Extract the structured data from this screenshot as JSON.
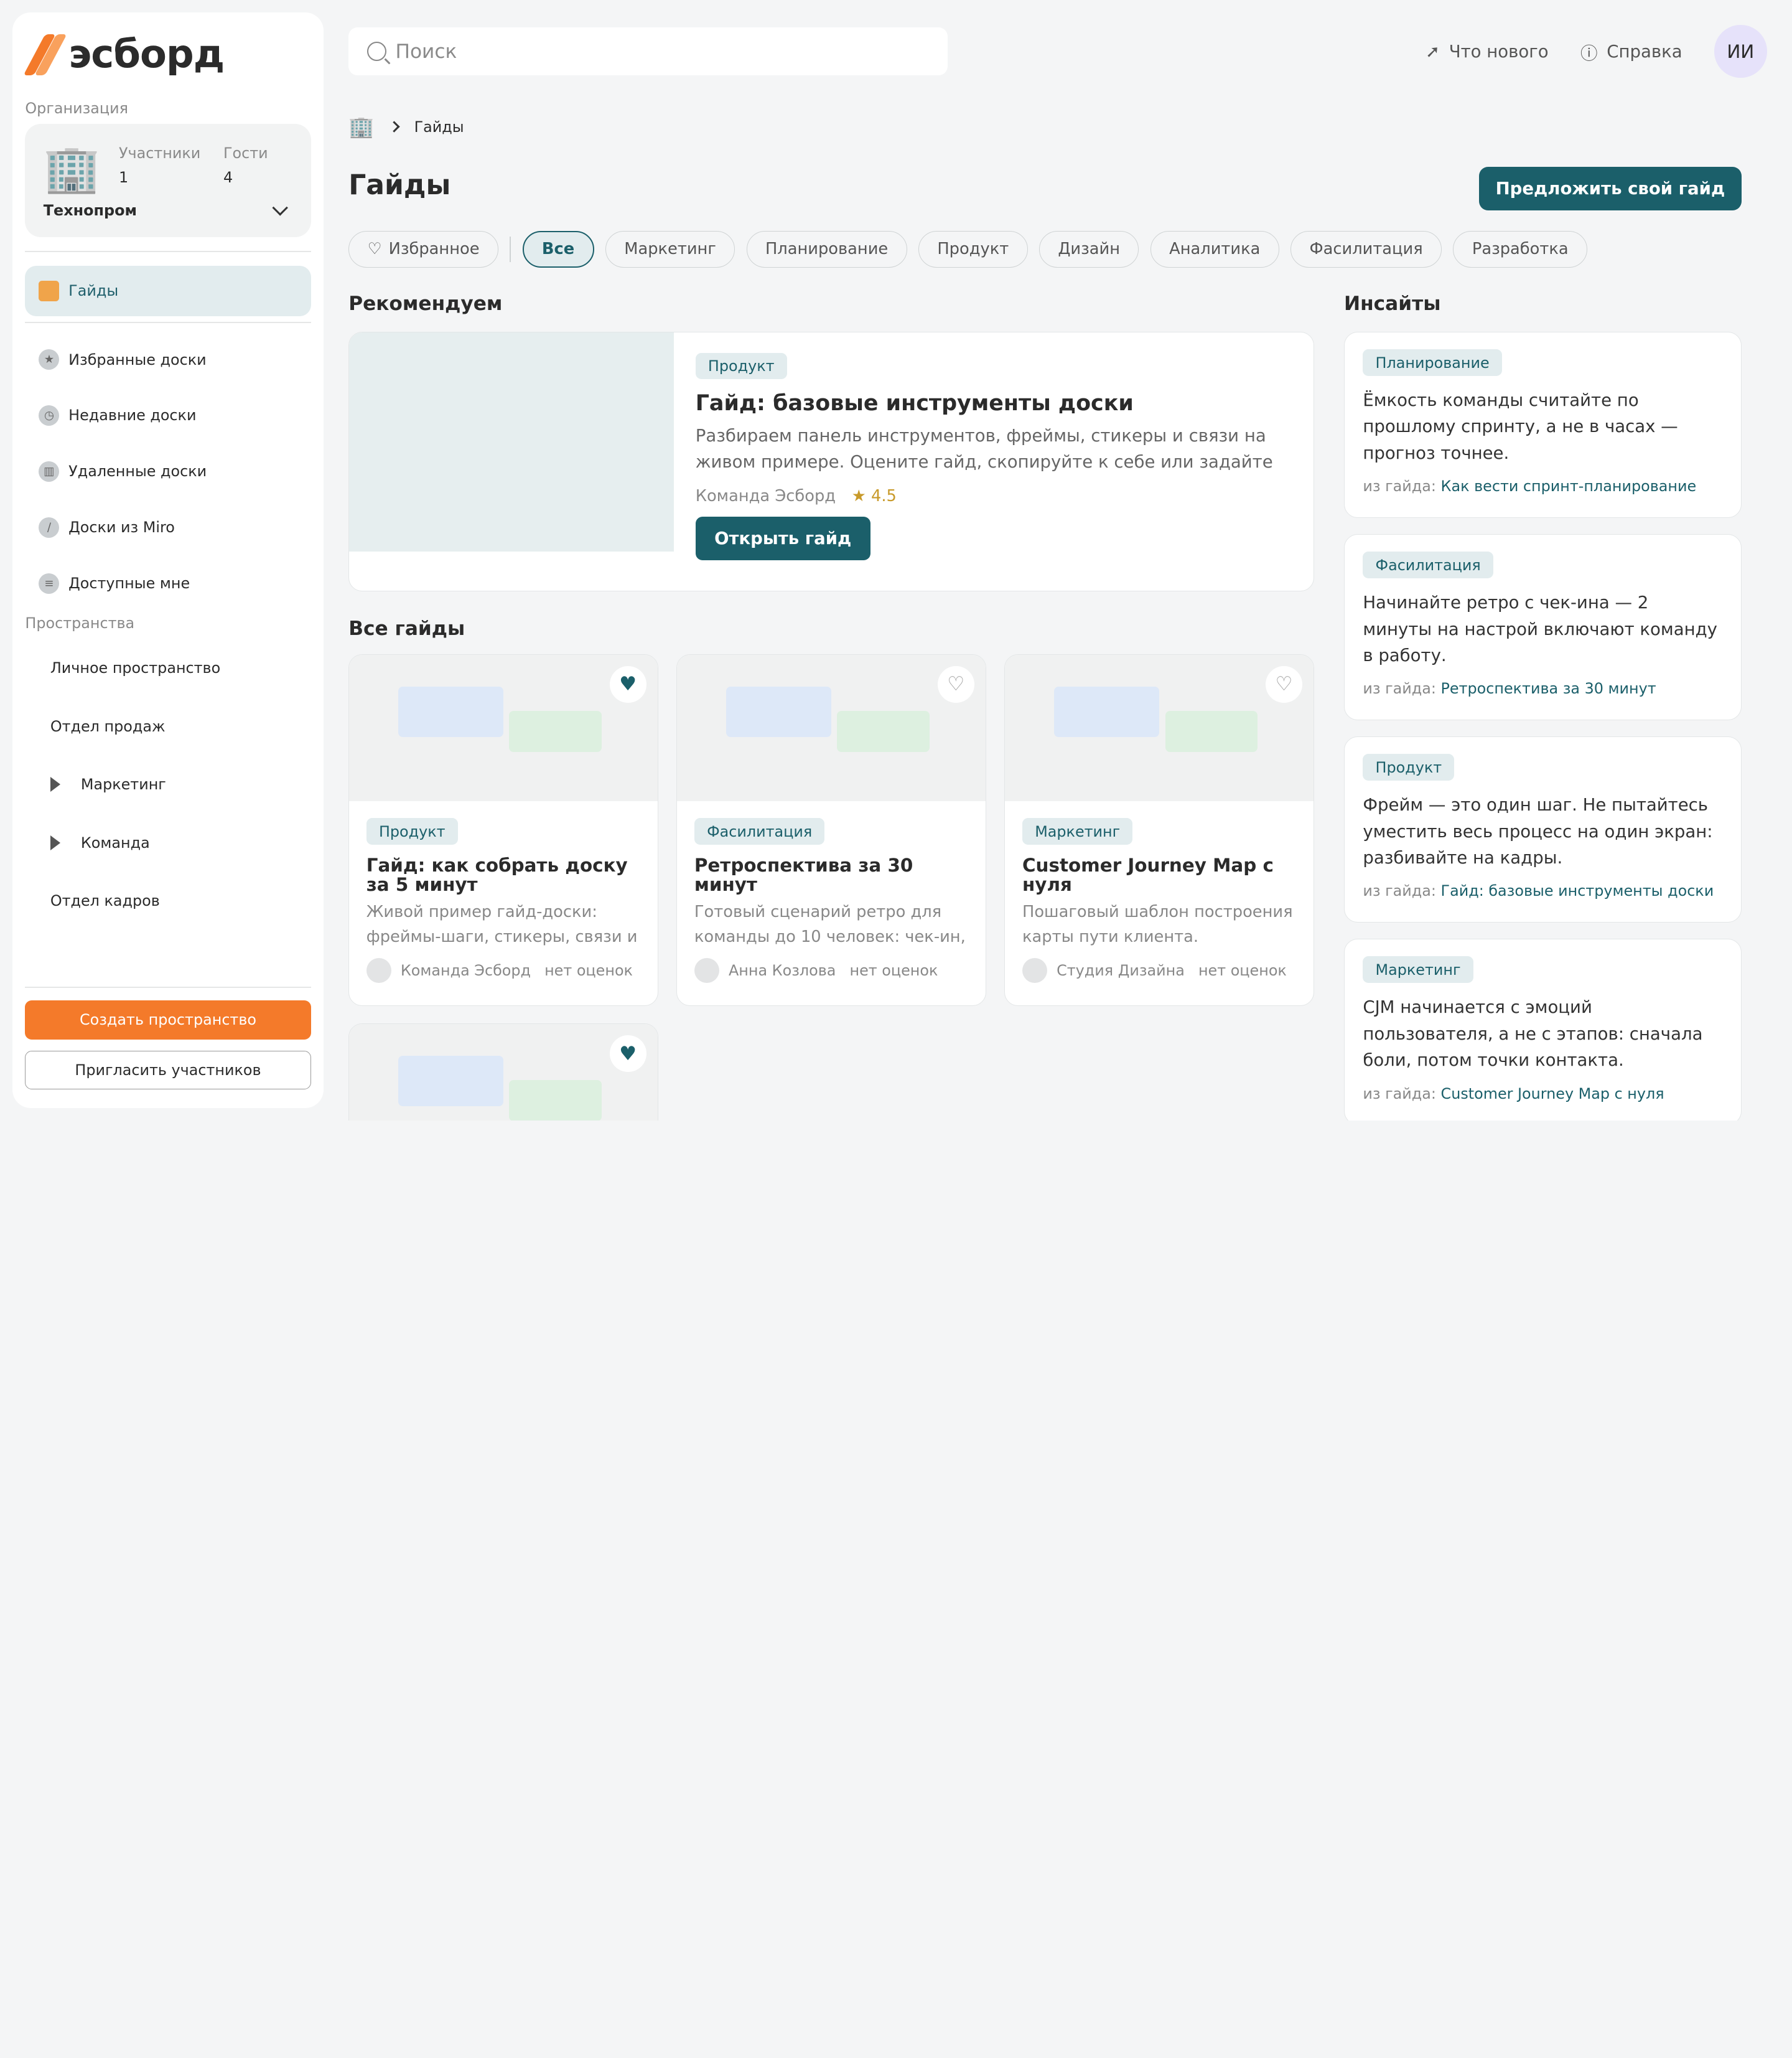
{
  "logo": {
    "text": "эсборд"
  },
  "sidebar": {
    "org_section_label": "Организация",
    "org": {
      "members_label": "Участники",
      "members_count": "1",
      "guests_label": "Гости",
      "guests_count": "4",
      "name": "Технопром"
    },
    "nav": [
      {
        "label": "Гайды",
        "icon": "book-icon",
        "active": true
      },
      {
        "label": "Избранные доски",
        "icon": "star-badge-icon"
      },
      {
        "label": "Недавние доски",
        "icon": "clock-icon"
      },
      {
        "label": "Удаленные доски",
        "icon": "trash-icon"
      },
      {
        "label": "Доски из Miro",
        "icon": "miro-icon"
      },
      {
        "label": "Доступные мне",
        "icon": "shared-doc-icon"
      }
    ],
    "spaces_label": "Пространства",
    "spaces": [
      {
        "label": "Личное пространство",
        "expandable": false
      },
      {
        "label": "Отдел продаж",
        "expandable": false
      },
      {
        "label": "Маркетинг",
        "expandable": true
      },
      {
        "label": "Команда",
        "expandable": true
      },
      {
        "label": "Отдел кадров",
        "expandable": false
      }
    ],
    "create_space_button": "Создать пространство",
    "invite_button": "Пригласить участников"
  },
  "header": {
    "search_placeholder": "Поиск",
    "whats_new": "Что нового",
    "help": "Справка",
    "avatar_initials": "ИИ"
  },
  "breadcrumb": {
    "current": "Гайды"
  },
  "page": {
    "title": "Гайды",
    "suggest_button": "Предложить свой гайд"
  },
  "filters": {
    "favorites": "Избранное",
    "items": [
      "Все",
      "Маркетинг",
      "Планирование",
      "Продукт",
      "Дизайн",
      "Аналитика",
      "Фасилитация",
      "Разработка"
    ],
    "active": "Все"
  },
  "recommended": {
    "heading": "Рекомендуем",
    "tag": "Продукт",
    "title": "Гайд: базовые инструменты доски",
    "description": "Разбираем панель инструментов, фреймы, стикеры и связи на живом примере. Оцените гайд, скопируйте к себе или задайте вопросы в комментариях.",
    "author": "Команда Эсборд",
    "rating": "★ 4.5",
    "open_button": "Открыть гайд"
  },
  "all_guides": {
    "heading": "Все гайды",
    "cards": [
      {
        "tag": "Продукт",
        "title": "Гайд: как собрать доску за 5 минут",
        "description": "Живой пример гайд-доски: фреймы-шаги, стикеры, связи и комментарии.",
        "author": "Команда Эсборд",
        "rating": "нет оценок",
        "favorited": true
      },
      {
        "tag": "Фасилитация",
        "title": "Ретроспектива за 30 минут",
        "description": "Готовый сценарий ретро для команды до 10 человек: чек-ин, сбор, голосование.",
        "author": "Анна Козлова",
        "rating": "нет оценок",
        "favorited": false
      },
      {
        "tag": "Маркетинг",
        "title": "Customer Journey Map с нуля",
        "description": "Пошаговый шаблон построения карты пути клиента.",
        "author": "Студия Дизайна",
        "rating": "нет оценок",
        "favorited": false
      },
      {
        "favorited": true
      }
    ]
  },
  "insights": {
    "heading": "Инсайты",
    "source_prefix": "из гайда:",
    "items": [
      {
        "tag": "Планирование",
        "text": "Ёмкость команды считайте по прошлому спринту, а не в часах — прогноз точнее.",
        "source": "Как вести спринт-планирование"
      },
      {
        "tag": "Фасилитация",
        "text": "Начинайте ретро с чек-ина — 2 минуты на настрой включают команду в работу.",
        "source": "Ретроспектива за 30 минут"
      },
      {
        "tag": "Продукт",
        "text": "Фрейм — это один шаг. Не пытайтесь уместить весь процесс на один экран: разбивайте на кадры.",
        "source": "Гайд: базовые инструменты доски"
      },
      {
        "tag": "Маркетинг",
        "text": "CJM начинается с эмоций пользователя, а не с этапов: сначала боли, потом точки контакта.",
        "source": "Customer Journey Map с нуля"
      }
    ]
  }
}
